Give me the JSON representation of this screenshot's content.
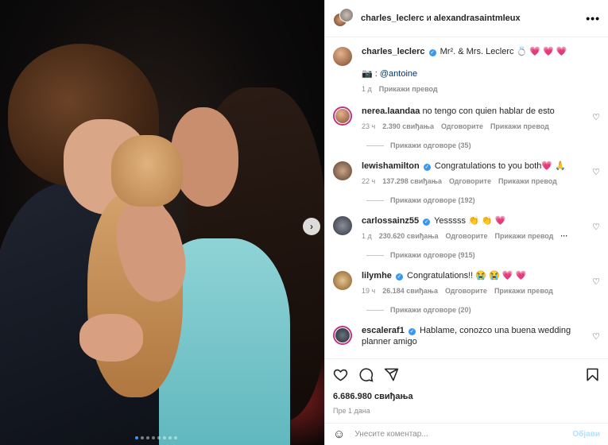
{
  "header": {
    "user1": "charles_leclerc",
    "and": "и",
    "user2": "alexandrasaintmleux",
    "more_icon": "more-horizontal-icon"
  },
  "caption": {
    "user": "charles_leclerc",
    "text": "Mr². & Mrs. Leclerc 💍 💗 💗 💗",
    "camera": "📷 :",
    "mention": "@antoine",
    "time": "1 д",
    "translate": "Прикажи превод"
  },
  "comments": [
    {
      "user": "nerea.laandaa",
      "verified": false,
      "text": "no tengo con quien hablar de esto",
      "time": "23 ч",
      "likes": "2.390 свиђања",
      "reply": "Одговорите",
      "translate": "Прикажи превод",
      "replies": "Прикажи одговоре (35)"
    },
    {
      "user": "lewishamilton",
      "verified": true,
      "text": "Congratulations to you both💗 🙏",
      "time": "22 ч",
      "likes": "137.298 свиђања",
      "reply": "Одговорите",
      "translate": "Прикажи превод",
      "replies": "Прикажи одговоре (192)"
    },
    {
      "user": "carlossainz55",
      "verified": true,
      "text": "Yesssss 👏 👏 💗",
      "time": "1 д",
      "likes": "230.620 свиђања",
      "reply": "Одговорите",
      "translate": "Прикажи превод",
      "extra": "···",
      "replies": "Прикажи одговоре (915)"
    },
    {
      "user": "lilymhe",
      "verified": true,
      "text": "Congratulations!! 😭 😭 💗 💗",
      "time": "19 ч",
      "likes": "26.184 свиђања",
      "reply": "Одговорите",
      "translate": "Прикажи превод",
      "replies": "Прикажи одговоре (20)"
    },
    {
      "user": "escaleraf1",
      "verified": true,
      "text": "Hablame, conozco una buena wedding planner amigo",
      "time": "",
      "likes": "",
      "reply": "",
      "translate": "",
      "replies": ""
    }
  ],
  "actions": {
    "likes": "6.686.980 свиђања",
    "date": "Пре 1 дана",
    "icons": [
      "heart-icon",
      "comment-icon",
      "share-icon",
      "bookmark-icon"
    ]
  },
  "comment_box": {
    "placeholder": "Унесите коментар...",
    "post": "Објави"
  },
  "carousel": {
    "slides": 8,
    "active": 0
  },
  "colors": {
    "accent": "#3897f0",
    "heart": "#ed4956",
    "story_ring": "#c13584"
  }
}
